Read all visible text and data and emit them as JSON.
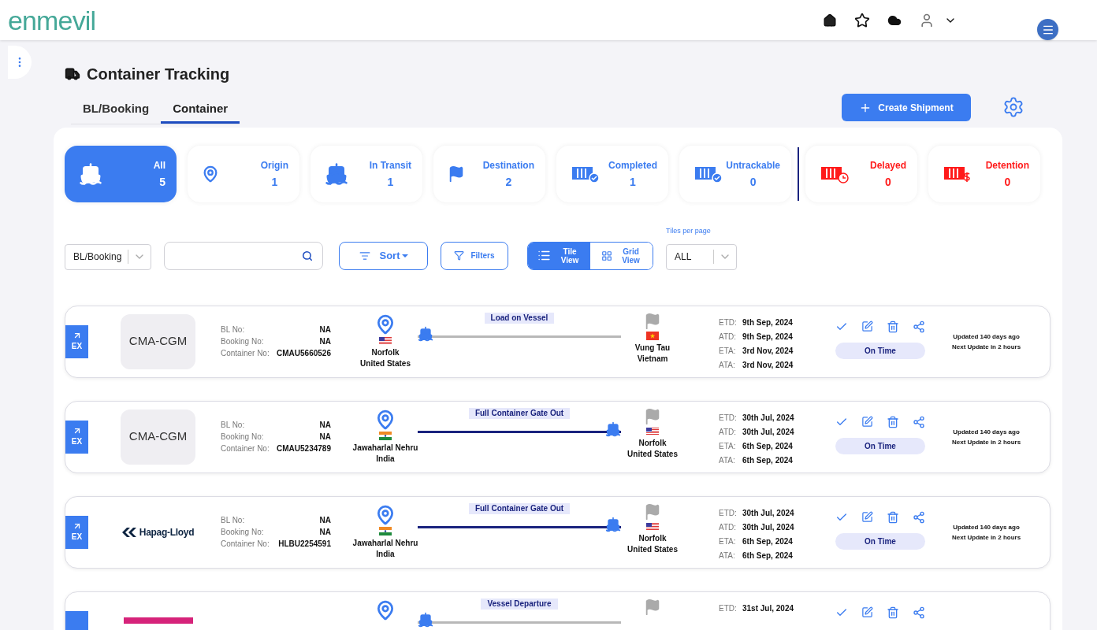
{
  "logo": "enmevil",
  "page": {
    "title": "Container Tracking"
  },
  "tabs": [
    {
      "label": "BL/Booking",
      "selected": false
    },
    {
      "label": "Container",
      "selected": true
    }
  ],
  "create_button": "Create Shipment",
  "stats": [
    {
      "label": "All",
      "count": "5",
      "kind": "all",
      "selected": true
    },
    {
      "label": "Origin",
      "count": "1",
      "kind": "origin",
      "selected": false
    },
    {
      "label": "In Transit",
      "count": "1",
      "kind": "transit",
      "selected": false
    },
    {
      "label": "Destination",
      "count": "2",
      "kind": "destination",
      "selected": false
    },
    {
      "label": "Completed",
      "count": "1",
      "kind": "completed",
      "selected": false
    },
    {
      "label": "Untrackable",
      "count": "0",
      "kind": "untrackable",
      "selected": false
    },
    {
      "label": "Delayed",
      "count": "0",
      "kind": "delayed",
      "selected": false
    },
    {
      "label": "Detention",
      "count": "0",
      "kind": "detention",
      "selected": false
    }
  ],
  "toolbar": {
    "search_type": "BL/Booking",
    "sort": "Sort",
    "filters": "Filters",
    "views": [
      {
        "label": "Tile View",
        "kind": "tile",
        "selected": true
      },
      {
        "label": "Grid View",
        "kind": "grid",
        "selected": false
      }
    ],
    "tiles_per_page_label": "Tiles per page",
    "tiles_per_page": "ALL"
  },
  "shipments": [
    {
      "tag": "EX",
      "carrier": {
        "kind": "text",
        "name": "CMA-CGM"
      },
      "fields": [
        {
          "label": "BL No:",
          "value": "NA"
        },
        {
          "label": "Booking No:",
          "value": "NA"
        },
        {
          "label": "Container No:",
          "value": "CMAU5660526"
        }
      ],
      "origin": {
        "city": "Norfolk",
        "country": "United States",
        "kind": "us"
      },
      "destination": {
        "city": "Vung Tau",
        "country": "Vietnam",
        "kind": "vn"
      },
      "event": "Load on Vessel",
      "level": 0,
      "dates": [
        {
          "label": "ETD:",
          "value": "9th Sep, 2024"
        },
        {
          "label": "ATD:",
          "value": "9th Sep, 2024"
        },
        {
          "label": "ETA:",
          "value": "3rd Nov, 2024"
        },
        {
          "label": "ATA:",
          "value": "3rd Nov, 2024"
        }
      ],
      "status": "On Time",
      "updated": "Updated 140 days ago",
      "next_update": "Next Update in 2 hours"
    },
    {
      "tag": "EX",
      "carrier": {
        "kind": "text",
        "name": "CMA-CGM"
      },
      "fields": [
        {
          "label": "BL No:",
          "value": "NA"
        },
        {
          "label": "Booking No:",
          "value": "NA"
        },
        {
          "label": "Container No:",
          "value": "CMAU5234789"
        }
      ],
      "origin": {
        "city": "Jawaharlal Nehru",
        "country": "India",
        "kind": "in"
      },
      "destination": {
        "city": "Norfolk",
        "country": "United States",
        "kind": "us"
      },
      "event": "Full Container Gate Out",
      "level": 1,
      "dates": [
        {
          "label": "ETD:",
          "value": "30th Jul, 2024"
        },
        {
          "label": "ATD:",
          "value": "30th Jul, 2024"
        },
        {
          "label": "ETA:",
          "value": "6th Sep, 2024"
        },
        {
          "label": "ATA:",
          "value": "6th Sep, 2024"
        }
      ],
      "status": "On Time",
      "updated": "Updated 140 days ago",
      "next_update": "Next Update in 2 hours"
    },
    {
      "tag": "EX",
      "carrier": {
        "kind": "logo",
        "name": "Hapag-Lloyd"
      },
      "fields": [
        {
          "label": "BL No:",
          "value": "NA"
        },
        {
          "label": "Booking No:",
          "value": "NA"
        },
        {
          "label": "Container No:",
          "value": "HLBU2254591"
        }
      ],
      "origin": {
        "city": "Jawaharlal Nehru",
        "country": "India",
        "kind": "in"
      },
      "destination": {
        "city": "Norfolk",
        "country": "United States",
        "kind": "us"
      },
      "event": "Full Container Gate Out",
      "level": 1,
      "dates": [
        {
          "label": "ETD:",
          "value": "30th Jul, 2024"
        },
        {
          "label": "ATD:",
          "value": "30th Jul, 2024"
        },
        {
          "label": "ETA:",
          "value": "6th Sep, 2024"
        },
        {
          "label": "ATA:",
          "value": "6th Sep, 2024"
        }
      ],
      "status": "On Time",
      "updated": "Updated 140 days ago",
      "next_update": "Next Update in 2 hours"
    },
    {
      "carrier": {
        "kind": "block"
      },
      "event": "Vessel Departure",
      "level": 0,
      "dates": [
        {
          "label": "ETD:",
          "value": "31st Jul, 2024"
        }
      ]
    }
  ]
}
